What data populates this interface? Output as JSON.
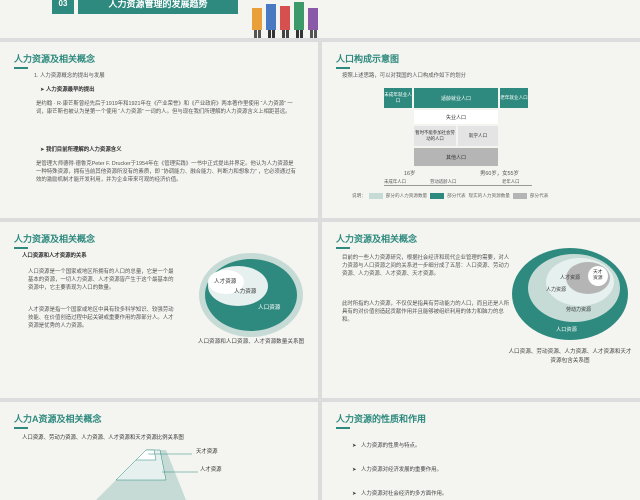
{
  "top": {
    "number": "03",
    "title": "人力资源管理的发展趋势"
  },
  "slide1": {
    "title": "人力资源及相关概念",
    "item1": "1.   人力资源概念的提出与发展",
    "sub1": "人力资源最早的提出",
    "para1": "是约翰 · R·康芒斯曾经先后于1919年和1921年在《产业荣誉》和《产业政府》两本著作里使用 “人力资源” 一词，康芒斯也被认为是第一个使用 “人力资源” 一词的人。但与现在我们所理解的人力资源含义上相距甚远。",
    "sub2": "我们目前所理解的人力资源含义",
    "para2": "是管理大师德得·德鲁克Peter F. Drucker于1954年在《管理实践》一书中正式提出并界定。他认为人力资源是一种特殊资源，拥有当前其他资源所没有的素质，即 “协调能力、融合能力、判断力和想象力” ，它必须通过有效的激励机制才能开发利用，并为企业带来可观的经济价值。"
  },
  "slide2": {
    "title": "人口构成示意图",
    "intro": "按照上述思路，可以对我国的人口构成作如下的划分",
    "box_left": "未成年就业人口",
    "box_center": "适龄就业人口",
    "box_right": "老年就业人口",
    "box_unemployed": "失业人口",
    "box_study": "暂时不能参加社会劳动的人口",
    "box_other": "其他人口",
    "box_army": "就学人口",
    "box_house": "家务人口",
    "age_left": "16岁",
    "age_right": "男60岁，女55岁",
    "axis1": "未成年人口",
    "axis2": "劳动适龄人口",
    "axis3": "老年人口",
    "legend_prefix": "说明：",
    "legend1": "部分的人力资源数量",
    "legend2": "部分代表",
    "legend3": "现实的人力资源数量",
    "legend4": "部分代表"
  },
  "slide3": {
    "title": "人力资源及相关概念",
    "sub": "人口资源和人才资源的关系",
    "para1": "人口资源是一个国家或地区所拥有的人口的总量，它是一个最基本的资源，一切人力资源、人才资源皆产生于这个最基本的资源中，它主要表现为人口的数量。",
    "para2": "人才资源是指一个国家或地区中具有较多科学知识、较强劳动技能、在价值创造过程中起关键或重要作用的那部分人。人才资源是优秀的人力资源。",
    "label_inner": "人才资源",
    "label_mid": "人力资源",
    "label_outer": "人口资源",
    "caption": "人口资源和人口资源、人才资源数量关系图"
  },
  "slide4": {
    "title": "人力资源及相关概念",
    "para1": "目前的一些人力资源研究，根据社会经济和现代企业管理的需要，对人力资源与人口资源之间的关系进一步细分成了五层：人口资源、劳动力资源、人力资源、人才资源、天才资源。",
    "para2": "此时所指的人力资源，不仅仅是指具有劳动能力的人口，而且还是人所具有的对价值创造起贡献作用并且能够被组织利用的体力和脑力的总和。",
    "label_genius": "天才资源",
    "label_talent": "人才资源",
    "label_hr": "人力资源",
    "label_labor": "劳动力资源",
    "label_pop": "人口资源",
    "caption": "人口资源、劳动资源、人力资源、人才资源和天才资源包含关系图"
  },
  "slide5": {
    "title": "人力A资源及相关概念",
    "subtitle": "人口资源、劳动力资源、人力资源、人才资源和天才资源比例关系图",
    "label_genius": "天才资源",
    "label_talent": "人才资源"
  },
  "slide6": {
    "title": "人力资源的性质和作用",
    "items": [
      "人力资源的性质与特点。",
      "人力资源对经济发展的重要作用。",
      "人力资源对社会经济的多方面作用。"
    ]
  },
  "colors": {
    "teal": "#2e8a7e",
    "mid": "#c6dbd6",
    "light": "#e6f0ee",
    "gray": "#b5b5b5"
  }
}
